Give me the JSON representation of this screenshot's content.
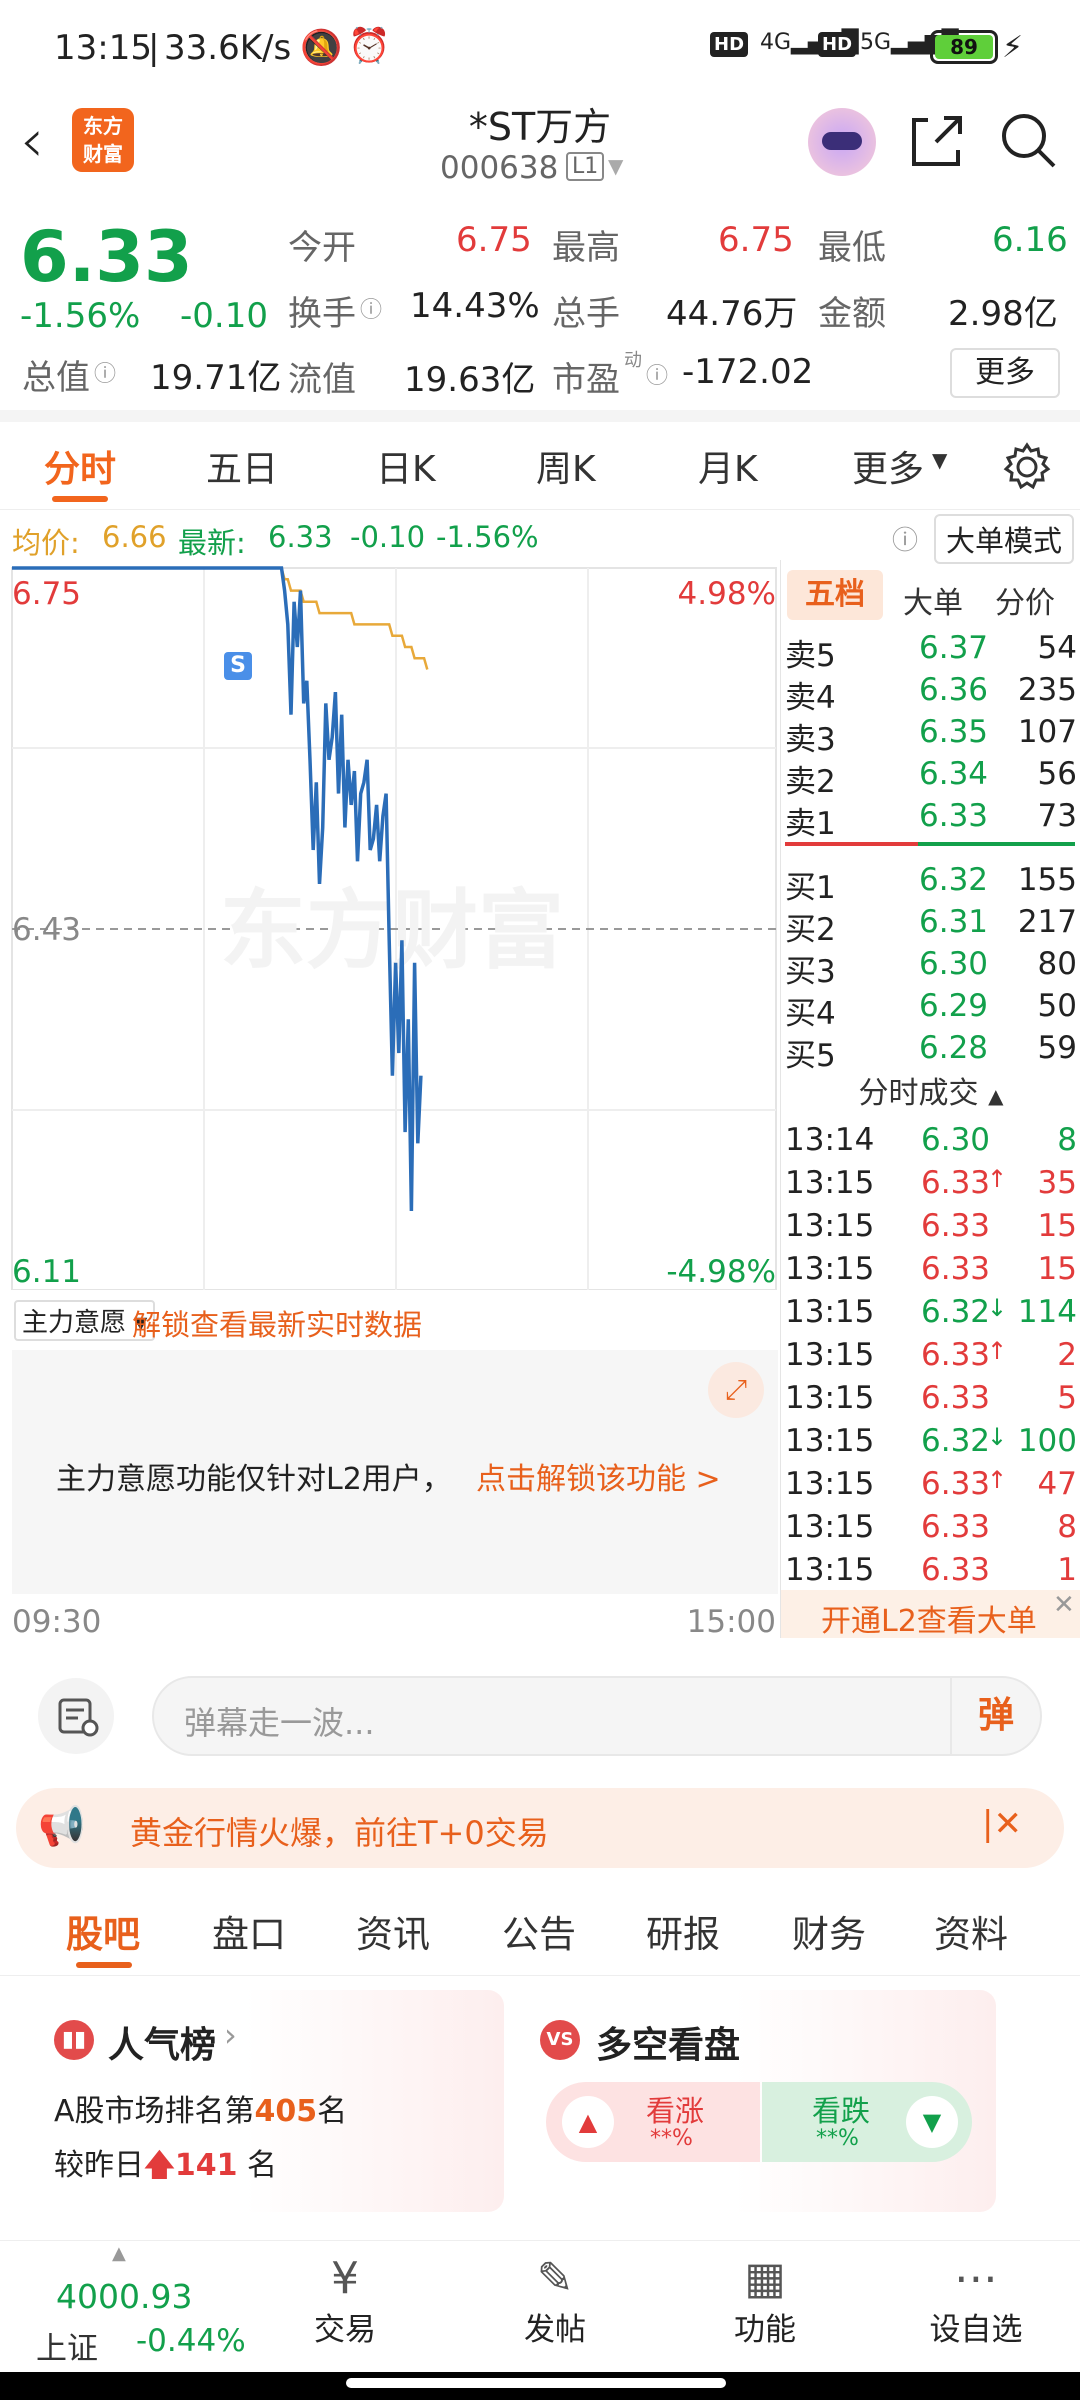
{
  "status": {
    "time": "13:15",
    "sep": "|",
    "speed": "33.6K/s",
    "battery": "89"
  },
  "nav": {
    "title": "*ST万方",
    "code": "000638",
    "level": "L1",
    "logo_line1": "东方",
    "logo_line2": "财富"
  },
  "quote": {
    "price": "6.33",
    "change_pct": "-1.56%",
    "change": "-0.10",
    "open_label": "今开",
    "open": "6.75",
    "high_label": "最高",
    "high": "6.75",
    "low_label": "最低",
    "low": "6.16",
    "turnover_label": "换手",
    "turnover": "14.43%",
    "volume_label": "总手",
    "volume": "44.76万",
    "amount_label": "金额",
    "amount": "2.98亿",
    "mktcap_label": "总值",
    "mktcap": "19.71亿",
    "float_label": "流值",
    "float": "19.63亿",
    "pe_label": "市盈",
    "pe_sup": "动",
    "pe": "-172.02",
    "more": "更多"
  },
  "tabs": [
    "分时",
    "五日",
    "日K",
    "周K",
    "月K",
    "更多"
  ],
  "chart_info": {
    "avg_label": "均价:",
    "avg": "6.66",
    "latest_label": "最新:",
    "latest": "6.33",
    "chg": "-0.10",
    "pct": "-1.56%",
    "mode": "大单模式"
  },
  "chart_data": {
    "type": "line",
    "y_top": "6.75",
    "y_mid": "6.43",
    "y_bottom": "6.11",
    "pct_top": "4.98%",
    "pct_bottom": "-4.98%",
    "x_start": "09:30",
    "x_end": "15:00",
    "ylim": [
      6.11,
      6.75
    ],
    "series": [
      {
        "values": [
          6.75,
          6.75,
          6.75,
          6.75,
          6.75,
          6.75,
          6.75,
          6.75,
          6.75,
          6.75,
          6.75,
          6.75,
          6.75,
          6.75,
          6.75,
          6.75,
          6.75,
          6.75,
          6.75,
          6.75,
          6.75,
          6.75,
          6.75,
          6.75,
          6.75,
          6.75,
          6.75,
          6.75,
          6.75,
          6.75,
          6.75,
          6.75,
          6.75,
          6.75,
          6.75,
          6.75,
          6.75,
          6.75,
          6.75,
          6.75,
          6.75,
          6.75,
          6.75,
          6.75,
          6.75,
          6.75,
          6.75,
          6.75,
          6.75,
          6.75,
          6.75,
          6.75,
          6.75,
          6.75,
          6.75,
          6.75,
          6.75,
          6.75,
          6.75,
          6.75,
          6.75,
          6.75,
          6.75,
          6.75,
          6.75,
          6.75,
          6.75,
          6.75,
          6.75,
          6.75,
          6.75,
          6.75,
          6.75,
          6.75,
          6.75,
          6.75,
          6.75,
          6.75,
          6.75,
          6.75,
          6.75,
          6.75,
          6.75,
          6.75,
          6.75,
          6.75,
          6.73,
          6.7,
          6.62,
          6.72,
          6.68,
          6.73,
          6.63,
          6.65,
          6.58,
          6.5,
          6.56,
          6.47,
          6.52,
          6.63,
          6.58,
          6.6,
          6.64,
          6.55,
          6.62,
          6.52,
          6.58,
          6.54,
          6.57,
          6.49,
          6.55,
          6.56,
          6.58,
          6.5,
          6.51,
          6.54,
          6.49,
          6.53,
          6.55,
          6.42,
          6.3,
          6.4,
          6.32,
          6.42,
          6.25,
          6.35,
          6.18,
          6.4,
          6.24,
          6.3
        ]
      },
      {
        "values": [
          6.75,
          6.75,
          6.75,
          6.75,
          6.75,
          6.75,
          6.75,
          6.75,
          6.75,
          6.75,
          6.75,
          6.75,
          6.75,
          6.75,
          6.75,
          6.75,
          6.75,
          6.75,
          6.75,
          6.75,
          6.75,
          6.75,
          6.75,
          6.75,
          6.75,
          6.75,
          6.75,
          6.75,
          6.75,
          6.75,
          6.75,
          6.75,
          6.75,
          6.75,
          6.75,
          6.75,
          6.75,
          6.75,
          6.75,
          6.75,
          6.75,
          6.75,
          6.75,
          6.75,
          6.75,
          6.75,
          6.75,
          6.75,
          6.75,
          6.75,
          6.75,
          6.75,
          6.75,
          6.75,
          6.75,
          6.75,
          6.75,
          6.75,
          6.75,
          6.75,
          6.75,
          6.75,
          6.75,
          6.75,
          6.75,
          6.75,
          6.75,
          6.75,
          6.75,
          6.75,
          6.75,
          6.75,
          6.75,
          6.75,
          6.75,
          6.75,
          6.75,
          6.75,
          6.75,
          6.75,
          6.75,
          6.75,
          6.75,
          6.75,
          6.75,
          6.75,
          6.74,
          6.74,
          6.73,
          6.73,
          6.73,
          6.73,
          6.72,
          6.72,
          6.72,
          6.72,
          6.72,
          6.71,
          6.71,
          6.71,
          6.71,
          6.71,
          6.71,
          6.71,
          6.71,
          6.71,
          6.71,
          6.71,
          6.7,
          6.7,
          6.7,
          6.7,
          6.7,
          6.7,
          6.7,
          6.7,
          6.7,
          6.7,
          6.7,
          6.7,
          6.69,
          6.69,
          6.69,
          6.69,
          6.68,
          6.68,
          6.68,
          6.67,
          6.67,
          6.67,
          6.67,
          6.66
        ]
      }
    ],
    "total_points": 242,
    "watermark": "东方财富",
    "marker": "S"
  },
  "book": {
    "tab_five": "五档",
    "tab_big": "大单",
    "tab_price": "分价",
    "asks": [
      {
        "label": "卖5",
        "price": "6.37",
        "vol": "54"
      },
      {
        "label": "卖4",
        "price": "6.36",
        "vol": "235"
      },
      {
        "label": "卖3",
        "price": "6.35",
        "vol": "107"
      },
      {
        "label": "卖2",
        "price": "6.34",
        "vol": "56"
      },
      {
        "label": "卖1",
        "price": "6.33",
        "vol": "73"
      }
    ],
    "bids": [
      {
        "label": "买1",
        "price": "6.32",
        "vol": "155"
      },
      {
        "label": "买2",
        "price": "6.31",
        "vol": "217"
      },
      {
        "label": "买3",
        "price": "6.30",
        "vol": "80"
      },
      {
        "label": "买4",
        "price": "6.29",
        "vol": "50"
      },
      {
        "label": "买5",
        "price": "6.28",
        "vol": "59"
      }
    ],
    "trades_title": "分时成交",
    "trades": [
      {
        "t": "13:14",
        "p": "6.30",
        "d": "",
        "v": "8",
        "c": "green"
      },
      {
        "t": "13:15",
        "p": "6.33",
        "d": "↑",
        "v": "35",
        "c": "red"
      },
      {
        "t": "13:15",
        "p": "6.33",
        "d": "",
        "v": "15",
        "c": "red"
      },
      {
        "t": "13:15",
        "p": "6.33",
        "d": "",
        "v": "15",
        "c": "red"
      },
      {
        "t": "13:15",
        "p": "6.32",
        "d": "↓",
        "v": "114",
        "c": "green"
      },
      {
        "t": "13:15",
        "p": "6.33",
        "d": "↑",
        "v": "2",
        "c": "red"
      },
      {
        "t": "13:15",
        "p": "6.33",
        "d": "",
        "v": "5",
        "c": "red"
      },
      {
        "t": "13:15",
        "p": "6.32",
        "d": "↓",
        "v": "100",
        "c": "green"
      },
      {
        "t": "13:15",
        "p": "6.33",
        "d": "↑",
        "v": "47",
        "c": "red"
      },
      {
        "t": "13:15",
        "p": "6.33",
        "d": "",
        "v": "8",
        "c": "red"
      },
      {
        "t": "13:15",
        "p": "6.33",
        "d": "",
        "v": "1",
        "c": "red"
      }
    ],
    "l2_banner": "开通L2查看大单"
  },
  "mainforce": {
    "label": "主力意愿",
    "unlock": "解锁查看最新实时数据",
    "msg": "主力意愿功能仅针对L2用户，",
    "link": "点击解锁该功能 >"
  },
  "danmu": {
    "placeholder": "弹幕走一波...",
    "btn": "弹"
  },
  "promo": {
    "text": "黄金行情火爆，前往T+0交易"
  },
  "bottom_tabs": [
    "股吧",
    "盘口",
    "资讯",
    "公告",
    "研报",
    "财务",
    "资料"
  ],
  "card_hot": {
    "title": "人气榜",
    "line1_pre": "A股市场排名第",
    "rank": "405",
    "line1_post": "名",
    "line2_pre": "较昨日",
    "delta": "141",
    "line2_post": "名"
  },
  "card_vs": {
    "title": "多空看盘",
    "up": "看涨",
    "down": "看跌",
    "pct": "**%"
  },
  "bottombar": {
    "index_value": "4000.93",
    "index_name": "上证",
    "index_chg": "-0.44%",
    "trade": "交易",
    "post": "发帖",
    "func": "功能",
    "watch": "设自选"
  }
}
